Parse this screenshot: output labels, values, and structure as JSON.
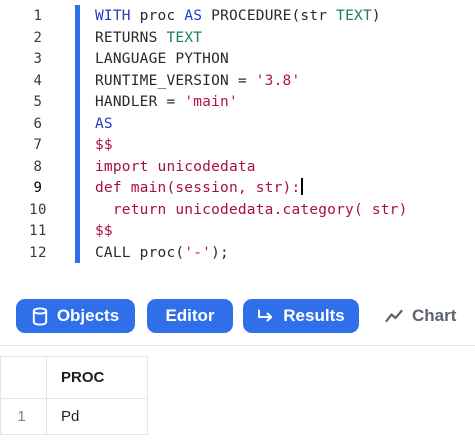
{
  "editor": {
    "line_numbers": [
      "1",
      "2",
      "3",
      "4",
      "5",
      "6",
      "7",
      "8",
      "9",
      "10",
      "11",
      "12"
    ],
    "active_line": 9,
    "lines": [
      [
        {
          "t": "WITH",
          "c": "kw"
        },
        {
          "t": " proc ",
          "c": "plain"
        },
        {
          "t": "AS",
          "c": "kw"
        },
        {
          "t": " PROCEDURE(str ",
          "c": "plain"
        },
        {
          "t": "TEXT",
          "c": "type"
        },
        {
          "t": ")",
          "c": "plain"
        }
      ],
      [
        {
          "t": "RETURNS ",
          "c": "plain"
        },
        {
          "t": "TEXT",
          "c": "type"
        }
      ],
      [
        {
          "t": "LANGUAGE PYTHON",
          "c": "plain"
        }
      ],
      [
        {
          "t": "RUNTIME_VERSION = ",
          "c": "plain"
        },
        {
          "t": "'3.8'",
          "c": "str"
        }
      ],
      [
        {
          "t": "HANDLER = ",
          "c": "plain"
        },
        {
          "t": "'main'",
          "c": "str"
        }
      ],
      [
        {
          "t": "AS",
          "c": "kw"
        }
      ],
      [
        {
          "t": "$$",
          "c": "py"
        }
      ],
      [
        {
          "t": "import unicodedata",
          "c": "py"
        }
      ],
      [
        {
          "t": "def main(session, str):",
          "c": "py"
        },
        {
          "t": "",
          "c": "cursor"
        }
      ],
      [
        {
          "t": "  return unicodedata.category( str)",
          "c": "py"
        }
      ],
      [
        {
          "t": "$$",
          "c": "py"
        }
      ],
      [
        {
          "t": "CALL proc(",
          "c": "plain"
        },
        {
          "t": "'-'",
          "c": "str"
        },
        {
          "t": ");",
          "c": "plain"
        }
      ]
    ]
  },
  "toolbar": {
    "objects_label": "Objects",
    "editor_label": "Editor",
    "results_label": "Results",
    "chart_label": "Chart"
  },
  "results": {
    "columns": [
      "PROC"
    ],
    "rows": [
      {
        "num": "1",
        "values": [
          "Pd"
        ]
      }
    ]
  },
  "colors": {
    "accent": "#2f6fea",
    "keyword": "#1f3cc7",
    "type": "#19805a",
    "string": "#b4144a",
    "python": "#a8103a"
  }
}
